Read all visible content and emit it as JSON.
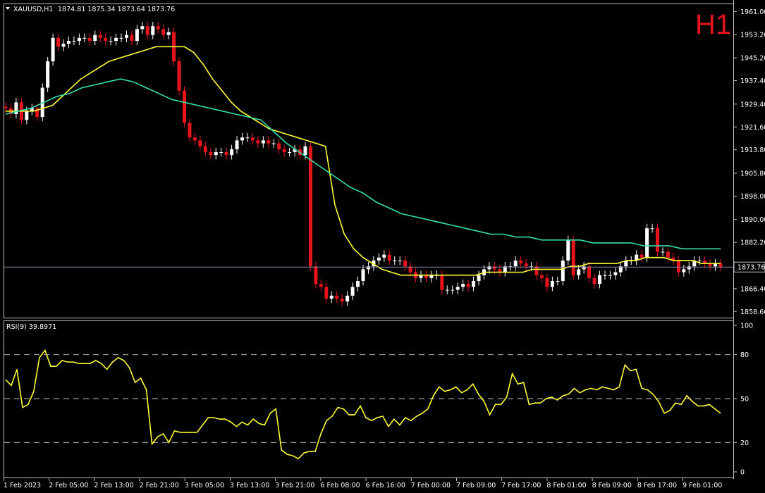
{
  "header": {
    "symbol": "XAUUSD,H1",
    "ohlc": "1874.81 1875.34 1873.64 1873.76",
    "timeframe_badge": "H1"
  },
  "colors": {
    "background": "#000000",
    "bull_candle": "#ffffff",
    "bear_candle": "#e8141c",
    "fast_ma": "#ffff33",
    "slow_ma": "#33e0b0",
    "rsi_line": "#ffff33",
    "price_line": "#8080a0"
  },
  "chart_data": [
    {
      "type": "candlestick",
      "title": "XAUUSD,H1",
      "ylim": [
        1856.5,
        1963.5
      ],
      "y_ticks": [
        "1961.00",
        "1953.20",
        "1945.20",
        "1937.40",
        "1929.40",
        "1921.60",
        "1913.80",
        "1905.80",
        "1898.00",
        "1890.00",
        "1882.20",
        "1874.20",
        "1866.40",
        "1858.60"
      ],
      "last_price_label": "1873.76",
      "last_price": 1873.76,
      "x_ticks": [
        "1 Feb 2023",
        "2 Feb 05:00",
        "2 Feb 13:00",
        "2 Feb 21:00",
        "3 Feb 05:00",
        "3 Feb 13:00",
        "3 Feb 21:00",
        "6 Feb 08:00",
        "6 Feb 16:00",
        "7 Feb 00:00",
        "7 Feb 09:00",
        "7 Feb 17:00",
        "8 Feb 01:00",
        "8 Feb 09:00",
        "8 Feb 17:00",
        "9 Feb 01:00"
      ],
      "closes": [
        1928,
        1926,
        1930,
        1924,
        1927,
        1928,
        1925,
        1935,
        1944,
        1952,
        1949,
        1950,
        1951,
        1951,
        1952,
        1952,
        1951,
        1953,
        1952,
        1951,
        1951,
        1952,
        1952,
        1953,
        1951,
        1955,
        1956,
        1953,
        1956,
        1955,
        1953,
        1954,
        1944,
        1934,
        1923,
        1918,
        1917,
        1915,
        1913,
        1912,
        1913,
        1913,
        1912,
        1914,
        1917,
        1918,
        1918,
        1917,
        1916,
        1917,
        1916,
        1916,
        1914,
        1913,
        1913,
        1914,
        1912,
        1915,
        1874,
        1868,
        1867,
        1863,
        1864,
        1863,
        1862,
        1864,
        1867,
        1869,
        1873,
        1874,
        1876,
        1877,
        1878,
        1876,
        1876,
        1876,
        1874,
        1872,
        1870,
        1871,
        1870,
        1871,
        1871,
        1866,
        1866,
        1866,
        1867,
        1868,
        1867,
        1869,
        1871,
        1873,
        1874,
        1873,
        1872,
        1874,
        1874,
        1876,
        1875,
        1874,
        1874,
        1871,
        1870,
        1867,
        1869,
        1869,
        1876,
        1883,
        1871,
        1873,
        1874,
        1870,
        1868,
        1871,
        1871,
        1871,
        1872,
        1874,
        1876,
        1876,
        1878,
        1877,
        1887,
        1887,
        1879,
        1879,
        1877,
        1876,
        1872,
        1873,
        1874,
        1876,
        1876,
        1875,
        1874,
        1875,
        1873.76
      ],
      "series": [
        {
          "name": "MA fast",
          "values": [
            1927,
            1927,
            1927,
            1927,
            1928,
            1929,
            1932,
            1935,
            1938,
            1940,
            1942,
            1944,
            1945,
            1946,
            1947,
            1948,
            1949,
            1949,
            1949,
            1949,
            1947,
            1943,
            1938,
            1934,
            1930,
            1927,
            1925,
            1923,
            1921,
            1920,
            1919,
            1918,
            1917,
            1916,
            1915,
            1895,
            1885,
            1880,
            1877,
            1875,
            1873,
            1872,
            1871,
            1871,
            1871,
            1871,
            1871,
            1871,
            1871,
            1871,
            1871,
            1872,
            1872,
            1872,
            1872,
            1872,
            1873,
            1873,
            1873,
            1873,
            1874,
            1874,
            1875,
            1875,
            1875,
            1875,
            1876,
            1876,
            1877,
            1877,
            1877,
            1876,
            1876,
            1876,
            1875,
            1875,
            1875
          ]
        },
        {
          "name": "MA slow",
          "values": [
            1926,
            1927,
            1928,
            1930,
            1932,
            1933,
            1935,
            1936,
            1937,
            1938,
            1937,
            1935,
            1933,
            1931,
            1930,
            1929,
            1928,
            1927,
            1926,
            1925,
            1924,
            1920,
            1916,
            1913,
            1910,
            1907,
            1904,
            1901,
            1899,
            1896,
            1894,
            1892,
            1891,
            1890,
            1889,
            1888,
            1887,
            1886,
            1885,
            1885,
            1884,
            1884,
            1883,
            1883,
            1883,
            1883,
            1882,
            1882,
            1882,
            1882,
            1881,
            1881,
            1881,
            1880,
            1880,
            1880,
            1880
          ]
        }
      ]
    },
    {
      "type": "line",
      "title": "RSI(9) 39.8971",
      "ylim": [
        0,
        100
      ],
      "y_ticks": [
        "100",
        "80",
        "50",
        "20",
        "0"
      ],
      "levels": [
        80,
        50,
        20
      ],
      "series": [
        {
          "name": "RSI(9)",
          "values": [
            63,
            59,
            70,
            44,
            46,
            55,
            78,
            83,
            72,
            72,
            76,
            75,
            75,
            74,
            74,
            74,
            76,
            74,
            70,
            75,
            78,
            76,
            71,
            61,
            64,
            56,
            19,
            24,
            26,
            20,
            28,
            27,
            27,
            27,
            27,
            32,
            37,
            37,
            36,
            36,
            34,
            31,
            34,
            32,
            36,
            33,
            32,
            40,
            43,
            15,
            12,
            11,
            9,
            13,
            14,
            14,
            26,
            35,
            38,
            44,
            43,
            39,
            39,
            45,
            37,
            35,
            37,
            38,
            31,
            36,
            32,
            37,
            35,
            38,
            40,
            43,
            52,
            58,
            55,
            56,
            58,
            54,
            56,
            60,
            53,
            48,
            39,
            46,
            46,
            51,
            67,
            60,
            61,
            46,
            47,
            47,
            50,
            51,
            49,
            52,
            53,
            57,
            54,
            56,
            57,
            56,
            58,
            57,
            56,
            58,
            73,
            69,
            70,
            57,
            56,
            53,
            48,
            40,
            42,
            47,
            46,
            52,
            48,
            45,
            45,
            46,
            43,
            40
          ]
        }
      ]
    }
  ]
}
